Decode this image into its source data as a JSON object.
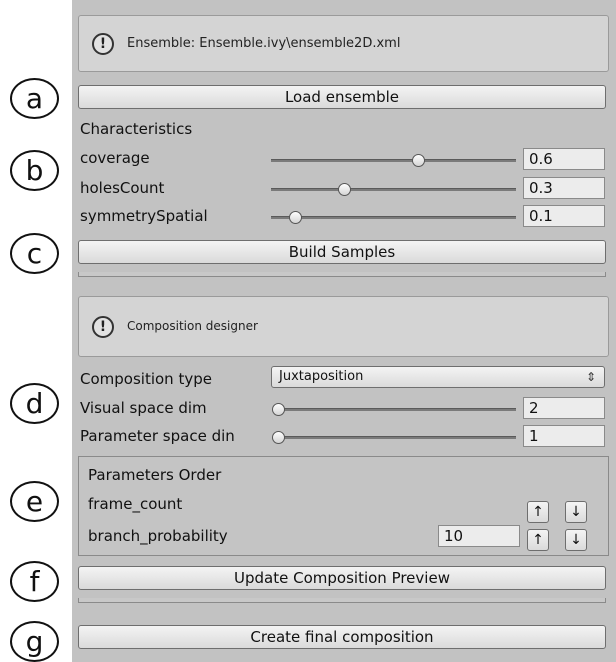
{
  "markers": [
    "a",
    "b",
    "c",
    "d",
    "e",
    "f",
    "g"
  ],
  "ensemble_help": {
    "icon": "warning-icon",
    "text": "Ensemble: Ensemble.ivy\\ensemble2D.xml"
  },
  "load_button": "Load ensemble",
  "characteristics": {
    "heading": "Characteristics",
    "items": [
      {
        "label": "coverage",
        "value": "0.6",
        "level": 0.6
      },
      {
        "label": "holesCount",
        "value": "0.3",
        "level": 0.3
      },
      {
        "label": "symmetrySpatial",
        "value": "0.1",
        "level": 0.1
      }
    ]
  },
  "build_button": "Build Samples",
  "composition_help": {
    "icon": "warning-icon",
    "text": "Composition designer"
  },
  "composition": {
    "type_label": "Composition type",
    "type_value": "Juxtaposition",
    "type_arrows": "⇕",
    "visual_dim_label": "Visual space dim",
    "visual_dim_value": "2",
    "param_dim_label": "Parameter space din",
    "param_dim_value": "1"
  },
  "parameters_order": {
    "heading": "Parameters Order",
    "items": [
      {
        "label": "frame_count",
        "value": ""
      },
      {
        "label": "branch_probability",
        "value": "10"
      }
    ],
    "up_glyph": "↑",
    "down_glyph": "↓"
  },
  "update_button": "Update Composition Preview",
  "final_button": "Create final composition"
}
